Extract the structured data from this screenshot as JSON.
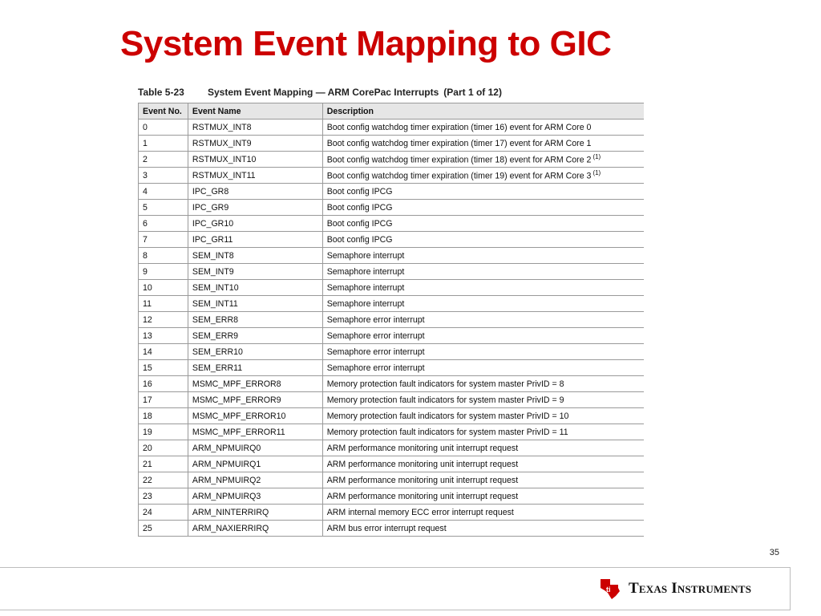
{
  "slide": {
    "title": "System Event Mapping to GIC",
    "page_number": "35"
  },
  "table": {
    "number": "Table 5-23",
    "caption": "System Event Mapping — ARM CorePac Interrupts",
    "part": "(Part 1 of 12)",
    "headers": [
      "Event No.",
      "Event Name",
      "Description"
    ],
    "rows": [
      {
        "no": "0",
        "name": "RSTMUX_INT8",
        "desc": "Boot config watchdog timer expiration (timer 16) event for ARM Core 0",
        "fn": ""
      },
      {
        "no": "1",
        "name": "RSTMUX_INT9",
        "desc": "Boot config watchdog timer expiration (timer 17) event for ARM Core 1",
        "fn": ""
      },
      {
        "no": "2",
        "name": "RSTMUX_INT10",
        "desc": "Boot config watchdog timer expiration (timer 18) event for ARM Core 2",
        "fn": "(1)"
      },
      {
        "no": "3",
        "name": "RSTMUX_INT11",
        "desc": "Boot config watchdog timer expiration (timer 19) event for ARM Core 3",
        "fn": "(1)"
      },
      {
        "no": "4",
        "name": "IPC_GR8",
        "desc": "Boot config IPCG",
        "fn": ""
      },
      {
        "no": "5",
        "name": "IPC_GR9",
        "desc": "Boot config IPCG",
        "fn": ""
      },
      {
        "no": "6",
        "name": "IPC_GR10",
        "desc": "Boot config IPCG",
        "fn": ""
      },
      {
        "no": "7",
        "name": "IPC_GR11",
        "desc": "Boot config IPCG",
        "fn": ""
      },
      {
        "no": "8",
        "name": "SEM_INT8",
        "desc": "Semaphore interrupt",
        "fn": ""
      },
      {
        "no": "9",
        "name": "SEM_INT9",
        "desc": "Semaphore interrupt",
        "fn": ""
      },
      {
        "no": "10",
        "name": "SEM_INT10",
        "desc": "Semaphore interrupt",
        "fn": ""
      },
      {
        "no": "11",
        "name": "SEM_INT11",
        "desc": "Semaphore interrupt",
        "fn": ""
      },
      {
        "no": "12",
        "name": "SEM_ERR8",
        "desc": "Semaphore error interrupt",
        "fn": ""
      },
      {
        "no": "13",
        "name": "SEM_ERR9",
        "desc": "Semaphore error interrupt",
        "fn": ""
      },
      {
        "no": "14",
        "name": "SEM_ERR10",
        "desc": "Semaphore error interrupt",
        "fn": ""
      },
      {
        "no": "15",
        "name": "SEM_ERR11",
        "desc": "Semaphore error interrupt",
        "fn": ""
      },
      {
        "no": "16",
        "name": "MSMC_MPF_ERROR8",
        "desc": "Memory protection fault indicators for system master PrivID = 8",
        "fn": ""
      },
      {
        "no": "17",
        "name": "MSMC_MPF_ERROR9",
        "desc": "Memory protection fault indicators for system master PrivID = 9",
        "fn": ""
      },
      {
        "no": "18",
        "name": "MSMC_MPF_ERROR10",
        "desc": "Memory protection fault indicators for system master PrivID = 10",
        "fn": ""
      },
      {
        "no": "19",
        "name": "MSMC_MPF_ERROR11",
        "desc": "Memory protection fault indicators for system master PrivID = 11",
        "fn": ""
      },
      {
        "no": "20",
        "name": "ARM_NPMUIRQ0",
        "desc": "ARM performance monitoring unit interrupt request",
        "fn": ""
      },
      {
        "no": "21",
        "name": "ARM_NPMUIRQ1",
        "desc": "ARM performance monitoring unit interrupt request",
        "fn": ""
      },
      {
        "no": "22",
        "name": "ARM_NPMUIRQ2",
        "desc": "ARM performance monitoring unit interrupt request",
        "fn": ""
      },
      {
        "no": "23",
        "name": "ARM_NPMUIRQ3",
        "desc": "ARM performance monitoring unit interrupt request",
        "fn": ""
      },
      {
        "no": "24",
        "name": "ARM_NINTERRIRQ",
        "desc": "ARM internal memory ECC error interrupt request",
        "fn": ""
      },
      {
        "no": "25",
        "name": "ARM_NAXIERRIRQ",
        "desc": "ARM bus error interrupt request",
        "fn": ""
      }
    ]
  },
  "footer": {
    "logo_text": "Texas Instruments",
    "logo_icon": "texas-state-icon",
    "logo_color": "#cc0000"
  },
  "colors": {
    "title": "#cc0000",
    "header_bg": "#e6e6e6",
    "rule": "#9a9a9a"
  }
}
